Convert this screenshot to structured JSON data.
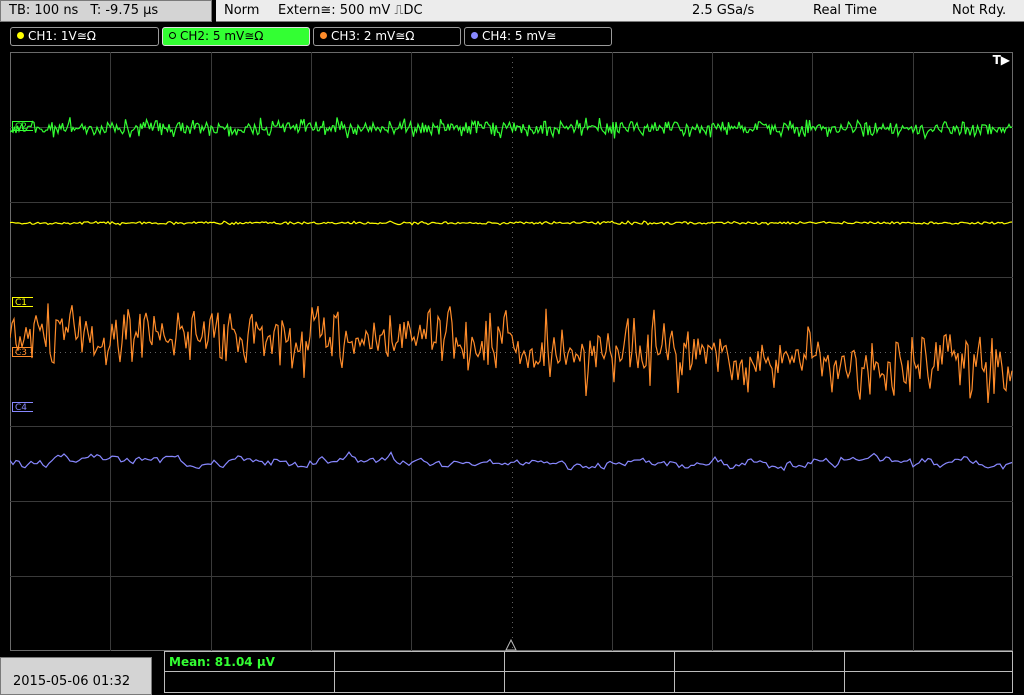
{
  "header": {
    "timebase": "TB: 100 ns",
    "trigger_time": "T: -9.75 µs",
    "trigger_mode": "Norm",
    "trigger_source": "Extern≅: 500 mV ⎍DC",
    "sample_rate": "2.5 GSa/s",
    "acq_mode": "Real Time",
    "status": "Not Rdy."
  },
  "channels": [
    {
      "label": "CH1: 1V≅Ω",
      "color": "#ffff00",
      "marker": "C1"
    },
    {
      "label": "CH2: 5 mV≅Ω",
      "color": "#33ff33",
      "marker": "C2"
    },
    {
      "label": "CH3: 2 mV≅Ω",
      "color": "#ff8c2a",
      "marker": "C3"
    },
    {
      "label": "CH4: 5 mV≅",
      "color": "#8888ff",
      "marker": "C4"
    }
  ],
  "trigger_marker": "T▶",
  "footer": {
    "datetime": "2015-05-06 01:32",
    "measurement": "Mean: 81.04 µV"
  },
  "colors": {
    "grid": "#3a3a3a",
    "axis": "#606060",
    "background": "#000000"
  }
}
